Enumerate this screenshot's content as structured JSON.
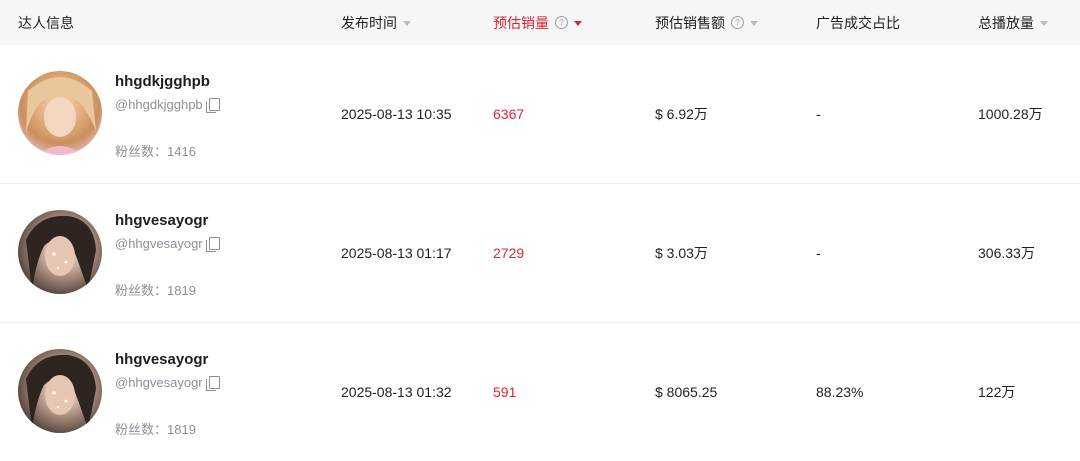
{
  "header": {
    "influencer_info": "达人信息",
    "publish_time": "发布时间",
    "est_sales": "预估销量",
    "est_revenue": "预估销售额",
    "ad_ratio": "广告成交占比",
    "total_views": "总播放量"
  },
  "colors": {
    "accent_red": "#e0242f",
    "header_bg": "#f5f6f8",
    "muted_text": "#8a8f99"
  },
  "rows": [
    {
      "name": "hhgdkjgghpb",
      "handle": "@hhgdkjgghpb",
      "fans": "粉丝数：1416",
      "time": "2025-08-13 10:35",
      "sales": "6367",
      "revenue": "$ 6.92万",
      "ad_ratio": "-",
      "views": "1000.28万"
    },
    {
      "name": "hhgvesayogr",
      "handle": "@hhgvesayogr",
      "fans": "粉丝数：1819",
      "time": "2025-08-13 01:17",
      "sales": "2729",
      "revenue": "$ 3.03万",
      "ad_ratio": "-",
      "views": "306.33万"
    },
    {
      "name": "hhgvesayogr",
      "handle": "@hhgvesayogr",
      "fans": "粉丝数：1819",
      "time": "2025-08-13 01:32",
      "sales": "591",
      "revenue": "$ 8065.25",
      "ad_ratio": "88.23%",
      "views": "122万"
    }
  ]
}
